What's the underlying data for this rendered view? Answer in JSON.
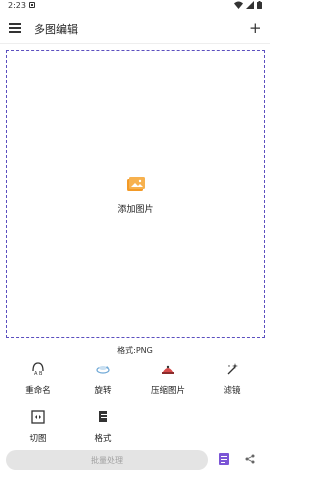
{
  "status_bar": {
    "time": "2:23"
  },
  "app_bar": {
    "title": "多图编辑"
  },
  "canvas": {
    "add_label": "添加图片"
  },
  "format_label": "格式:PNG",
  "tools": [
    {
      "label": "重命名",
      "icon": "rename-icon"
    },
    {
      "label": "旋转",
      "icon": "rotate-icon"
    },
    {
      "label": "压缩图片",
      "icon": "compress-icon"
    },
    {
      "label": "滤镜",
      "icon": "filter-icon"
    },
    {
      "label": "切图",
      "icon": "crop-icon"
    },
    {
      "label": "格式",
      "icon": "format-icon"
    }
  ],
  "bottom": {
    "batch_label": "批量处理"
  },
  "colors": {
    "accent": "#5b4fbf",
    "image_icon": "#f39a27",
    "disabled_button": "#e4e4e4"
  }
}
